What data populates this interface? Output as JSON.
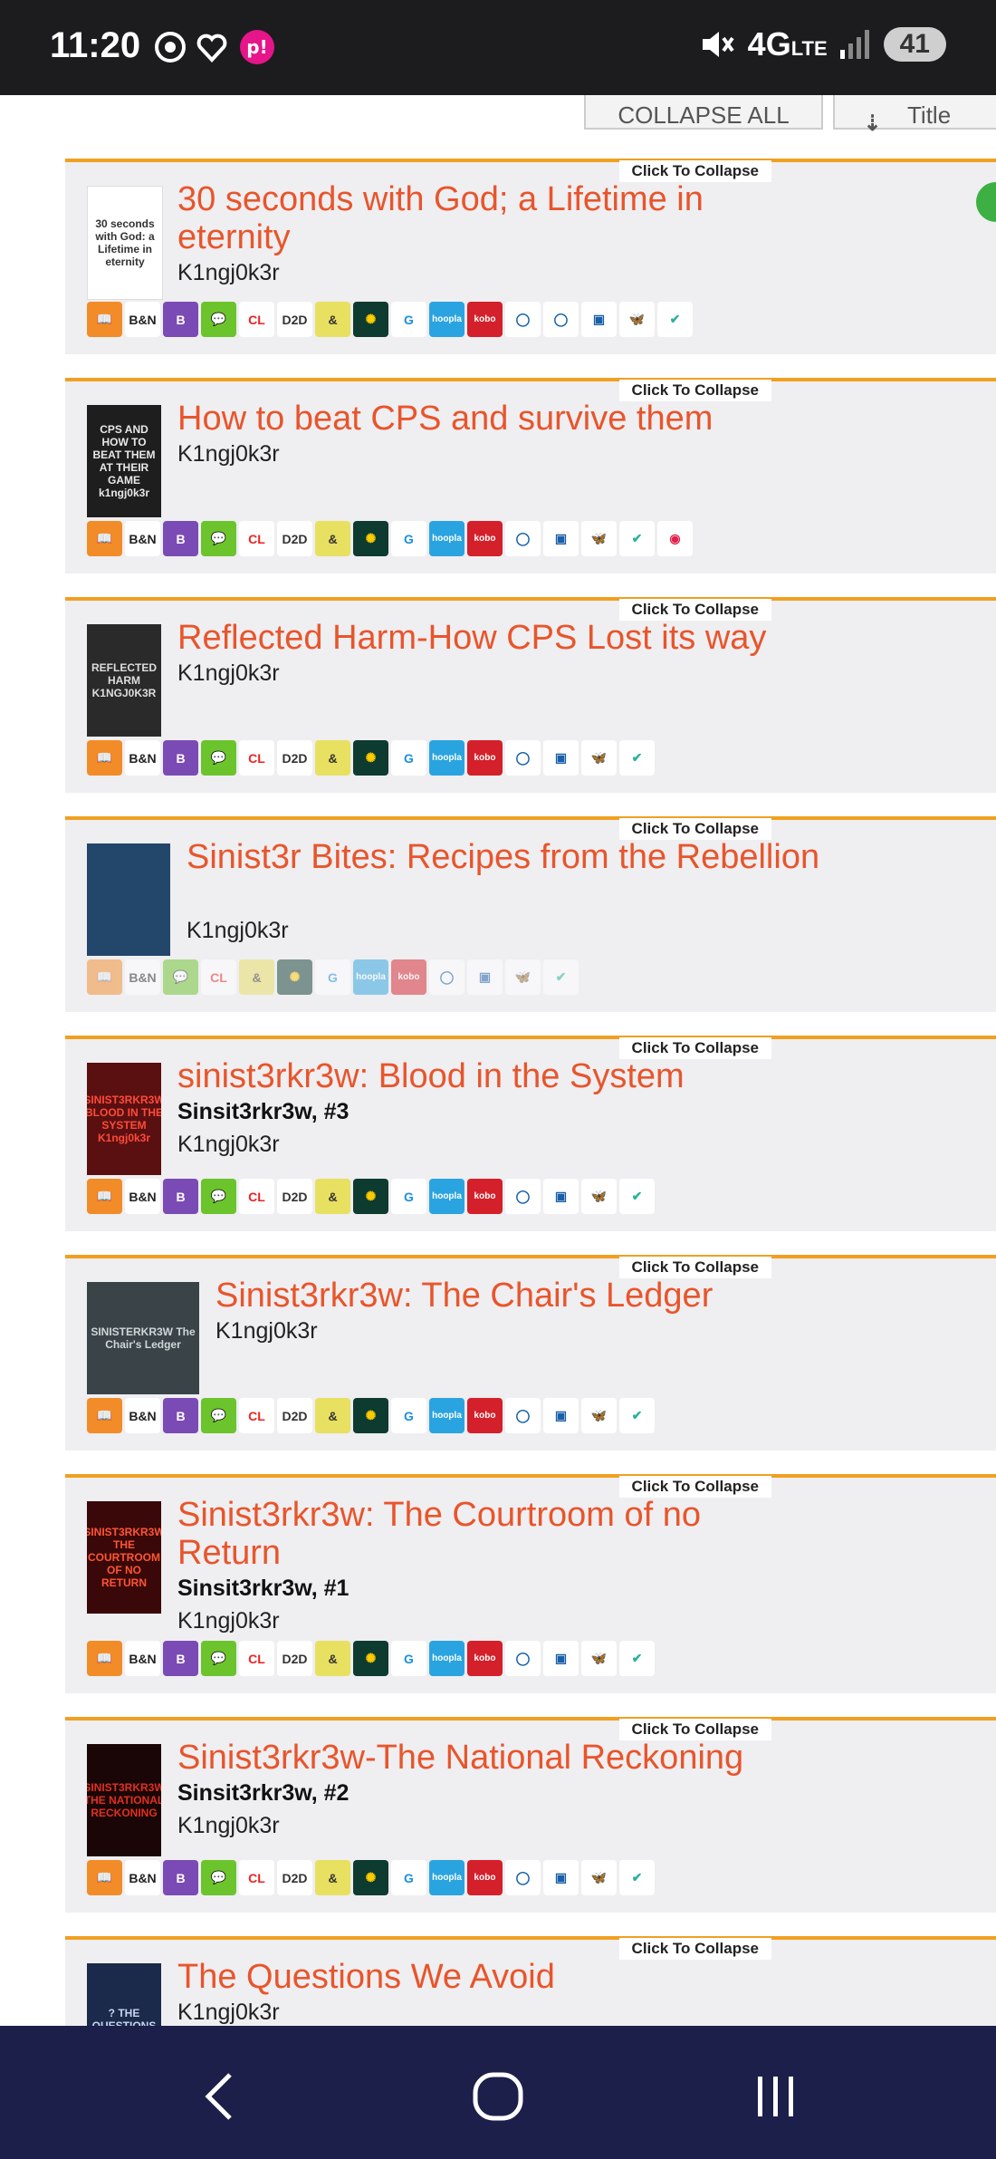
{
  "status": {
    "time": "11:20",
    "network": "4G",
    "lte": "LTE",
    "battery": "41"
  },
  "toolbar": {
    "collapse_all": "COLLAPSE ALL",
    "sort": "Title",
    "sort_icon": "sort-icon"
  },
  "collapse_label": "Click To Collapse",
  "books": [
    {
      "title": "30 seconds with God; a Lifetime in eternity",
      "author": "K1ngj0k3r",
      "cover": {
        "text": "30 seconds with God: a Lifetime in eternity",
        "bg": "#ffffff",
        "fg": "#333333"
      },
      "icons": [
        "books",
        "bn",
        "B",
        "chat",
        "CL",
        "D2D AUDIO",
        "&",
        "peacock",
        "G",
        "hoopla",
        "kobo",
        "O",
        "O",
        "reader",
        "bsky",
        "check"
      ]
    },
    {
      "title": "How to beat CPS and survive them",
      "author": "K1ngj0k3r",
      "cover": {
        "text": "CPS AND HOW TO BEAT THEM AT THEIR GAME k1ngj0k3r",
        "bg": "#1e1e1e",
        "fg": "#e8e8e8"
      },
      "icons": [
        "books",
        "bn",
        "B",
        "chat",
        "CL",
        "D2D PRINT",
        "&",
        "peacock",
        "G",
        "hoopla",
        "kobo",
        "O",
        "reader",
        "bsky",
        "check",
        "circle"
      ]
    },
    {
      "title": "Reflected Harm-How CPS Lost its way",
      "author": "K1ngj0k3r",
      "cover": {
        "text": "REFLECTED HARM K1NGJ0K3R",
        "bg": "#2a2a2a",
        "fg": "#dddddd"
      },
      "icons": [
        "books",
        "bn",
        "B",
        "chat",
        "CL",
        "D2D PRINT",
        "&",
        "peacock",
        "G",
        "hoopla",
        "kobo",
        "O",
        "reader",
        "bsky",
        "check"
      ]
    },
    {
      "title": "Sinist3r Bites: Recipes from the Rebellion",
      "author": "K1ngj0k3r",
      "faded": true,
      "cover": {
        "text": "",
        "bg": "#23466b",
        "fg": "#ffffff"
      },
      "icons": [
        "books",
        "bn",
        "chat",
        "CL",
        "&",
        "peacock",
        "G",
        "hoopla",
        "kobo",
        "O",
        "reader",
        "bsky",
        "check"
      ]
    },
    {
      "title": "sinist3rkr3w: Blood in the System",
      "series": "Sinsit3rkr3w, #3",
      "author": "K1ngj0k3r",
      "cover": {
        "text": "SINIST3RKR3W BLOOD IN THE SYSTEM K1ngj0k3r",
        "bg": "#5a1010",
        "fg": "#ff4a3a"
      },
      "icons": [
        "books",
        "bn",
        "B",
        "chat",
        "CL",
        "D2D PRINT",
        "&",
        "peacock",
        "G",
        "hoopla",
        "kobo",
        "O",
        "reader",
        "bsky",
        "check"
      ]
    },
    {
      "title": "Sinist3rkr3w: The Chair's Ledger",
      "author": "K1ngj0k3r",
      "cover": {
        "text": "SINISTERKR3W The Chair's Ledger",
        "bg": "#3a4448",
        "fg": "#cfd6d8"
      },
      "icons": [
        "books",
        "bn",
        "B",
        "chat",
        "CL",
        "D2D PRINT",
        "&",
        "peacock",
        "G",
        "hoopla",
        "kobo",
        "O",
        "reader",
        "bsky",
        "check"
      ]
    },
    {
      "title": "Sinist3rkr3w: The Courtroom of no Return",
      "series": "Sinsit3rkr3w, #1",
      "author": "K1ngj0k3r",
      "cover": {
        "text": "SINIST3RKR3W THE COURTROOM OF NO RETURN",
        "bg": "#3a0808",
        "fg": "#ff5533"
      },
      "icons": [
        "books",
        "bn",
        "B",
        "chat",
        "CL",
        "D2D PRINT",
        "&",
        "peacock",
        "G",
        "hoopla",
        "kobo",
        "O",
        "reader",
        "bsky",
        "check"
      ]
    },
    {
      "title": "Sinist3rkr3w-The National Reckoning",
      "series": "Sinsit3rkr3w, #2",
      "author": "K1ngj0k3r",
      "cover": {
        "text": "SINIST3RKR3W THE NATIONAL RECKONING",
        "bg": "#1a0606",
        "fg": "#e03020"
      },
      "icons": [
        "books",
        "bn",
        "B",
        "chat",
        "CL",
        "D2D PRINT",
        "&",
        "peacock",
        "G",
        "hoopla",
        "kobo",
        "O",
        "reader",
        "bsky",
        "check"
      ]
    },
    {
      "title": "The Questions We Avoid",
      "author": "K1ngj0k3r",
      "cover": {
        "text": "? THE QUESTIONS",
        "bg": "#1b2a4a",
        "fg": "#c8d4f0"
      },
      "icons": []
    }
  ],
  "nav": {
    "back": "back-icon",
    "home": "home-icon",
    "recents": "recents-icon"
  },
  "colors": {
    "accent": "#e8552b",
    "divider": "#f0a020",
    "card_bg": "#efeef1",
    "navbar": "#1b1f4a"
  }
}
